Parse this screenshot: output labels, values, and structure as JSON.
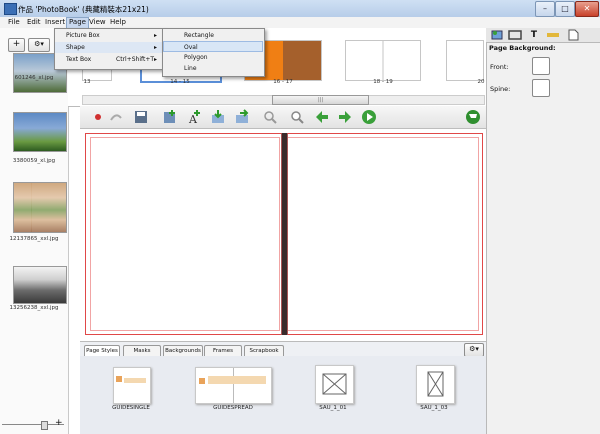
{
  "window": {
    "title": "作品 'PhotoBook' (典藏精裝本21x21)",
    "buttons": {
      "minimize": "–",
      "maximize": "□",
      "close": "✕"
    }
  },
  "menubar": {
    "items": [
      "File",
      "Edit",
      "Insert",
      "Page",
      "View",
      "Help"
    ]
  },
  "page_menu": {
    "items": [
      {
        "label": "Picture Box",
        "shortcut": "",
        "submenu": "▸"
      },
      {
        "label": "Shape",
        "shortcut": "",
        "submenu": "▸"
      },
      {
        "label": "Text Box",
        "shortcut": "Ctrl+Shift+T",
        "submenu": "▸"
      }
    ]
  },
  "shape_menu": {
    "items": [
      "Rectangle",
      "Oval",
      "Polygon",
      "Line"
    ],
    "selected": "Oval"
  },
  "left_panel": {
    "add_button": "+",
    "settings_button": "⚙▾",
    "photos": [
      {
        "caption": "601246_xl.jpg"
      },
      {
        "caption": "3380059_xl.jpg"
      },
      {
        "caption": "12137865_xxl.jpg"
      },
      {
        "caption": "13256238_xxl.jpg"
      }
    ],
    "zoom_plus": "+"
  },
  "page_strip": {
    "spreads": [
      {
        "caption": "13"
      },
      {
        "caption": "14 - 15"
      },
      {
        "caption": "16 - 17"
      },
      {
        "caption": "18 - 19"
      },
      {
        "caption": "20"
      }
    ],
    "scroll_grip": "|||"
  },
  "main_toolbar": {
    "icons": [
      "record-icon",
      "redo-icon",
      "save-icon",
      "add-page-icon",
      "add-text-icon",
      "import-icon",
      "export-icon",
      "zoom-out-icon",
      "zoom-in-icon",
      "previous-icon",
      "next-icon",
      "play-icon",
      "cart-icon"
    ]
  },
  "bottom_tabs": {
    "tabs": [
      "Page Styles",
      "Masks",
      "Backgrounds",
      "Frames",
      "Scrapbook"
    ],
    "active": "Page Styles",
    "settings_button": "⚙▾"
  },
  "page_styles": [
    {
      "caption": "GUIDESINGLE"
    },
    {
      "caption": "GUIDESPREAD"
    },
    {
      "caption": "SAU_1_01"
    },
    {
      "caption": "SAU_1_03"
    }
  ],
  "right_panel": {
    "title": "Page Background:",
    "front_label": "Front:",
    "spine_label": "Spine:",
    "tab_text_icon": "T"
  },
  "colors": {
    "accent": "#3b6fb5",
    "page_border": "#e04848",
    "spine": "#3a2a2a",
    "orange_page": "#f07f14",
    "brown_page": "#a5602c"
  }
}
